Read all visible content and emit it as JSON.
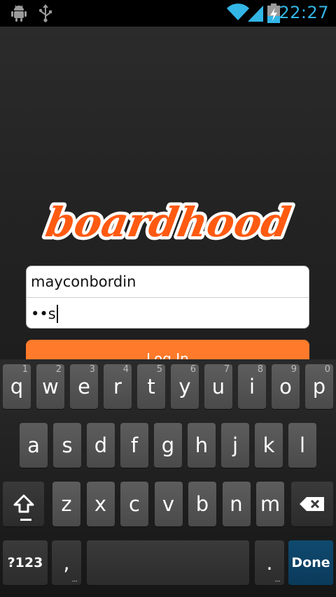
{
  "status_bar": {
    "time": "22:27",
    "icons": [
      "android-debug-icon",
      "usb-icon",
      "wifi-icon",
      "signal-icon",
      "battery-charging-icon"
    ],
    "accent_color": "#33b5e5"
  },
  "app": {
    "logo_text": "boardhood",
    "logo_color": "#ff5a12",
    "username_value": "mayconbordin",
    "password_value": "••s",
    "login_button_label": "Log In",
    "button_color": "#ff7a2b"
  },
  "keyboard": {
    "row1": [
      {
        "label": "q",
        "hint": "1"
      },
      {
        "label": "w",
        "hint": "2"
      },
      {
        "label": "e",
        "hint": "3"
      },
      {
        "label": "r",
        "hint": "4"
      },
      {
        "label": "t",
        "hint": "5"
      },
      {
        "label": "y",
        "hint": "6"
      },
      {
        "label": "u",
        "hint": "7"
      },
      {
        "label": "i",
        "hint": "8"
      },
      {
        "label": "o",
        "hint": "9"
      },
      {
        "label": "p",
        "hint": "0"
      }
    ],
    "row2": [
      "a",
      "s",
      "d",
      "f",
      "g",
      "h",
      "j",
      "k",
      "l"
    ],
    "row3": [
      "z",
      "x",
      "c",
      "v",
      "b",
      "n",
      "m"
    ],
    "symbols_label": "?123",
    "comma_label": ",",
    "period_label": ".",
    "done_label": "Done",
    "done_color": "#0f4a70"
  }
}
